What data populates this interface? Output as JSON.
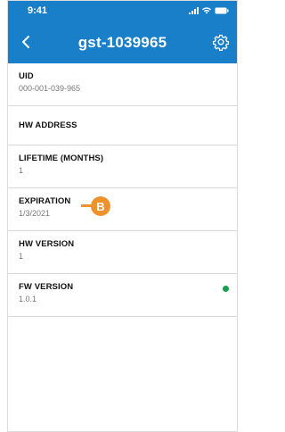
{
  "status_bar": {
    "time": "9:41"
  },
  "header": {
    "title": "gst-1039965"
  },
  "fields": [
    {
      "label": "UID",
      "value": "000-001-039-965"
    },
    {
      "label": "HW ADDRESS",
      "value": ""
    },
    {
      "label": "LIFETIME (MONTHS)",
      "value": "1"
    },
    {
      "label": "EXPIRATION",
      "value": "1/3/2021"
    },
    {
      "label": "HW VERSION",
      "value": "1"
    },
    {
      "label": "FW VERSION",
      "value": "1.0.1"
    }
  ],
  "annotation": {
    "badge": "B"
  },
  "colors": {
    "header": "#1a7fc9",
    "status_ok": "#1a9e4b",
    "annotation": "#f0922b"
  },
  "icons": {
    "back": "chevron-left-icon",
    "settings": "gear-icon"
  }
}
